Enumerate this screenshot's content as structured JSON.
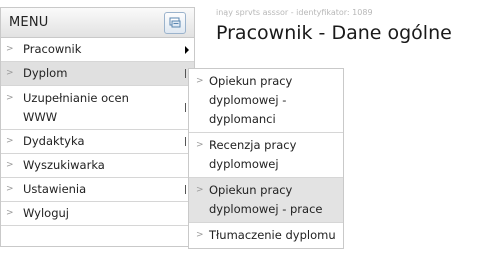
{
  "header": {
    "breadcrumb": "inąy sprvts asssor - identyfikator: 1089",
    "title": "Pracownik - Dane ogólne"
  },
  "menu": {
    "title": "MENU",
    "toggle_icon": "menu-collapse-icon",
    "items": [
      {
        "label": "Pracownik",
        "arrow": "solid"
      },
      {
        "label": "Dyplom",
        "arrow": "line",
        "active": true
      },
      {
        "label": "Uzupełnianie ocen WWW",
        "arrow": "line"
      },
      {
        "label": "Dydaktyka",
        "arrow": "line"
      },
      {
        "label": "Wyszukiwarka",
        "arrow": "none"
      },
      {
        "label": "Ustawienia",
        "arrow": "line"
      },
      {
        "label": "Wyloguj",
        "arrow": "none"
      }
    ]
  },
  "submenu": {
    "items": [
      {
        "label": "Opiekun pracy dyplomowej - dyplomanci"
      },
      {
        "label": "Recenzja pracy dyplomowej"
      },
      {
        "label": "Opiekun pracy dyplomowej - prace",
        "highlight": true
      },
      {
        "label": "Tłumaczenie dyplomu"
      }
    ]
  },
  "colors": {
    "border": "#c9c9c9",
    "active_bg": "#e0e0e0",
    "chevron": "#9a9a9a"
  }
}
